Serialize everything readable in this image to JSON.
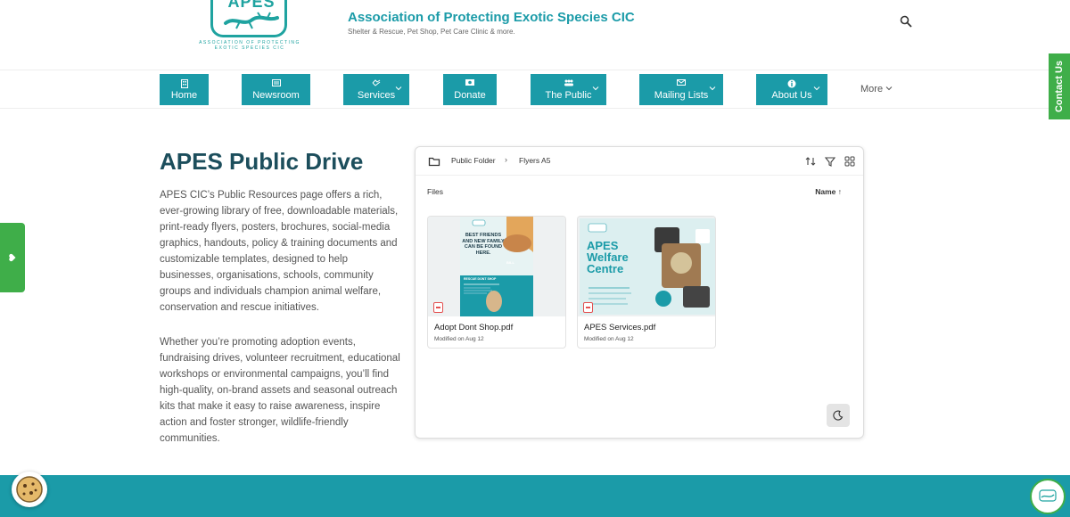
{
  "header": {
    "logo_text": "APES",
    "logo_caption_line1": "ASSOCIATION OF PROTECTING",
    "logo_caption_line2": "EXOTIC SPECIES CIC",
    "title": "Association of Protecting Exotic Species CIC",
    "subtitle": "Shelter & Rescue, Pet Shop, Pet Care Clinic & more."
  },
  "nav": {
    "items": [
      {
        "label": "Home",
        "icon": "building-icon"
      },
      {
        "label": "Newsroom",
        "icon": "newspaper-icon"
      },
      {
        "label": "Services",
        "icon": "handshake-icon",
        "dropdown": true
      },
      {
        "label": "Donate",
        "icon": "money-icon"
      },
      {
        "label": "The Public",
        "icon": "people-icon",
        "dropdown": true
      },
      {
        "label": "Mailing Lists",
        "icon": "mail-icon",
        "dropdown": true
      },
      {
        "label": "About Us",
        "icon": "info-icon",
        "dropdown": true
      }
    ],
    "more_label": "More"
  },
  "side_tabs": {
    "contact": "Contact Us",
    "donate": "Donate"
  },
  "main": {
    "title": "APES Public Drive",
    "para1": "APES CIC’s Public Resources page offers a rich, ever-growing library of free, downloadable materials, print-ready flyers, posters, brochures, social-media graphics, handouts, policy & training documents and customizable templates, designed to help businesses, organisations, schools, community groups and individuals champion animal welfare, conservation and rescue initiatives.",
    "para2": "Whether you’re promoting adoption events, fundraising drives, volunteer recruitment, educational workshops or environmental campaigns, you’ll find high-quality, on-brand assets and seasonal outreach kits that make it easy to raise awareness, inspire action and foster stronger, wildlife-friendly communities."
  },
  "drive": {
    "breadcrumb_root": "Public Folder",
    "breadcrumb_sep": "›",
    "breadcrumb_current": "Flyers A5",
    "files_label": "Files",
    "sort_label": "Name ↑",
    "files": [
      {
        "name": "Adopt Dont Shop.pdf",
        "modified": "Modified on Aug 12",
        "thumb_text": "BEST FRIENDS AND NEW FAMILY CAN BE FOUND HERE.",
        "thumb_sub": "BILL",
        "thumb_footer": "RESCUE DONT SHOP"
      },
      {
        "name": "APES Services.pdf",
        "modified": "Modified on Aug 12",
        "thumb_title": "APES Welfare Centre"
      }
    ]
  },
  "colors": {
    "brand_teal": "#1b9ba8",
    "title_navy": "#1c4e5c",
    "green": "#3fae49"
  }
}
